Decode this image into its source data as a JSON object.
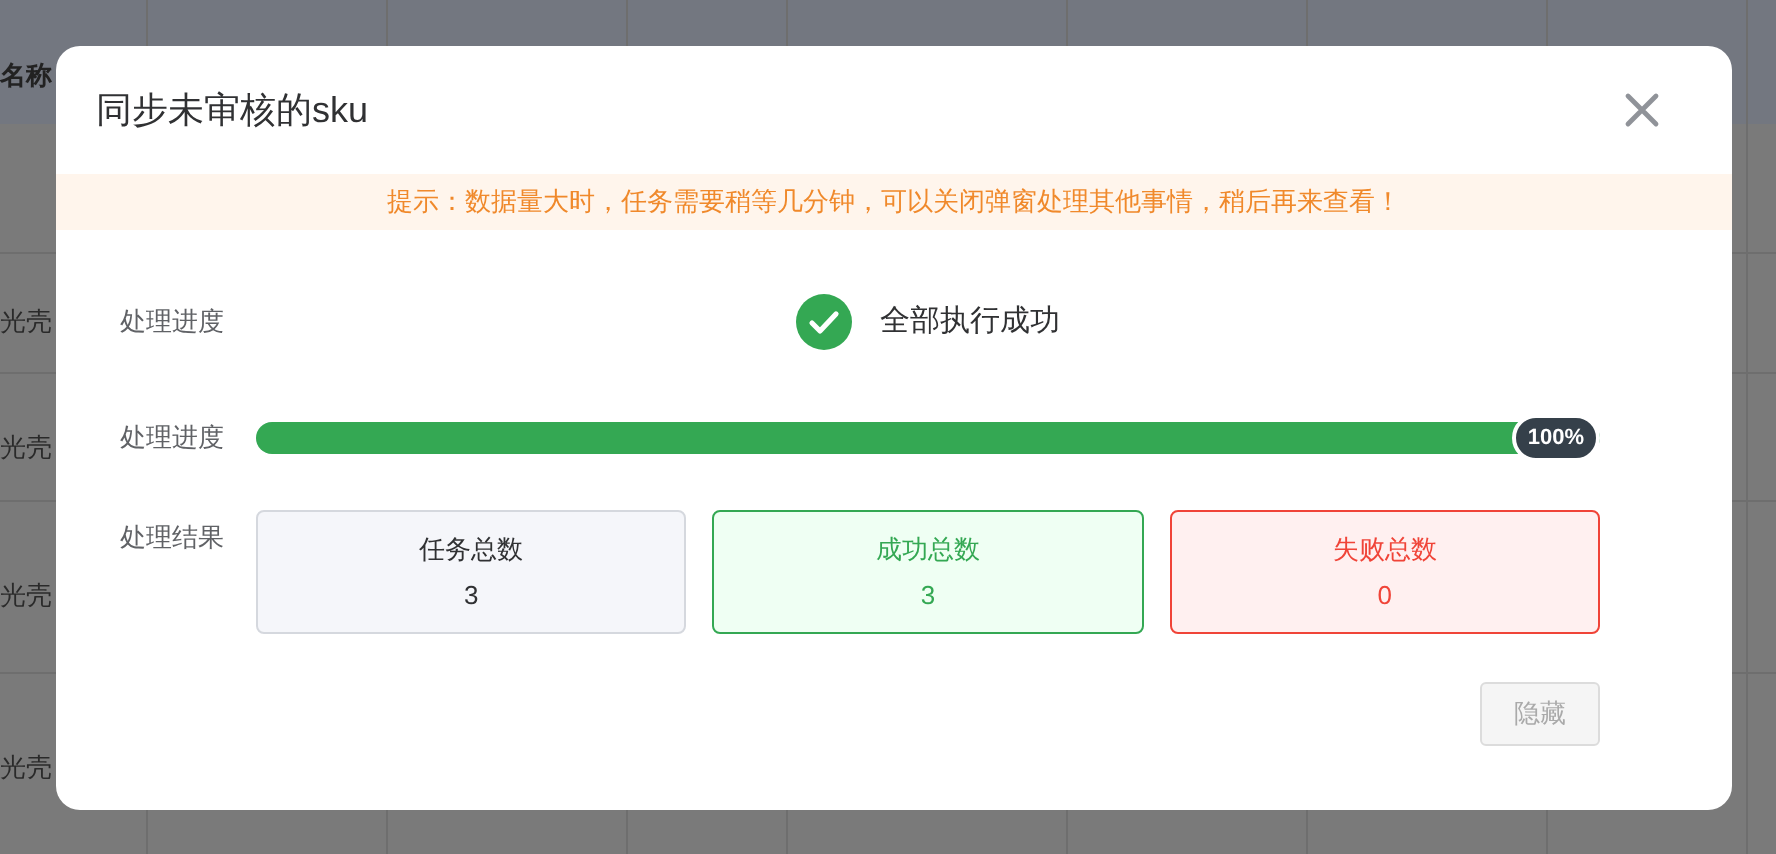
{
  "background_table": {
    "header": [
      "名称"
    ],
    "rows": [
      "光壳",
      "光壳",
      "光壳",
      "光壳"
    ]
  },
  "dialog": {
    "title": "同步未审核的sku",
    "notice": "提示：数据量大时，任务需要稍等几分钟，可以关闭弹窗处理其他事情，稍后再来查看！",
    "status": {
      "label": "处理进度",
      "text": "全部执行成功",
      "success": true
    },
    "progress": {
      "label": "处理进度",
      "level": 1,
      "reading": "100%"
    },
    "results": {
      "label": "处理结果",
      "cards": [
        {
          "kind": "total",
          "title": "任务总数",
          "value": "3"
        },
        {
          "kind": "success",
          "title": "成功总数",
          "value": "3"
        },
        {
          "kind": "fail",
          "title": "失败总数",
          "value": "0"
        }
      ]
    },
    "button": {
      "label": "隐藏",
      "disabled": true
    }
  }
}
